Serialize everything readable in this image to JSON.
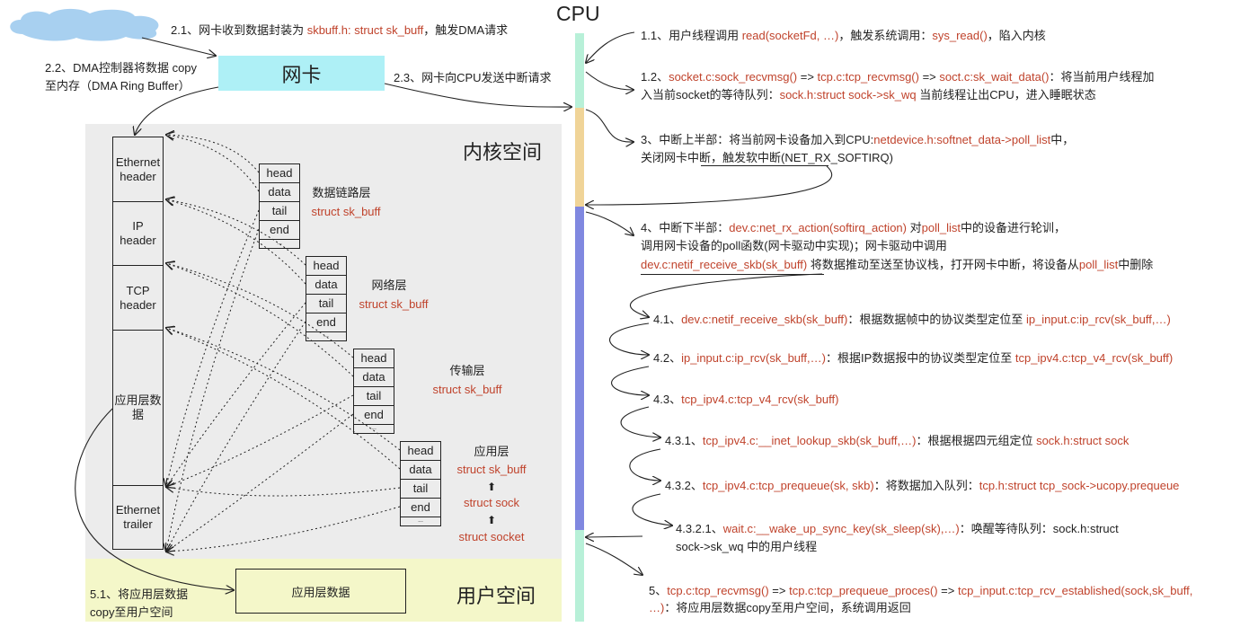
{
  "cpu_label": "CPU",
  "nic_label": "网卡",
  "kernel_space_label": "内核空间",
  "user_space_label": "用户空间",
  "colors": {
    "nic": "#aef0f6",
    "cpu_user": "#b8f0d8",
    "cpu_hardirq": "#f0d498",
    "cpu_softirq": "#8088e0",
    "kernel": "#ececec",
    "user": "#f4f7c9",
    "highlight": "#c0432c",
    "cloud": "#a8d0f0"
  },
  "left_notes": {
    "n21": [
      {
        "t": "2.1、网卡收到数据封装为 "
      },
      {
        "t": "skbuff.h: struct sk_buff",
        "hl": true
      },
      {
        "t": "，触发DMA请求"
      }
    ],
    "n22a": [
      {
        "t": "2.2、DMA控制器将数据 copy"
      }
    ],
    "n22b": [
      {
        "t": "至内存（DMA Ring Buffer）"
      }
    ],
    "n23": [
      {
        "t": "2.3、网卡向CPU发送中断请求"
      }
    ],
    "n51a": [
      {
        "t": "5.1、将应用层数据"
      }
    ],
    "n51b": [
      {
        "t": "copy至用户空间"
      }
    ]
  },
  "packet": [
    "Ethernet header",
    "IP header",
    "TCP header",
    "应用层数据",
    "Ethernet trailer"
  ],
  "skbuff_fields": [
    "head",
    "data",
    "tail",
    "end",
    "..."
  ],
  "layers": [
    {
      "name": "数据链路层",
      "struct": "struct sk_buff"
    },
    {
      "name": "网络层",
      "struct": "struct sk_buff"
    },
    {
      "name": "传输层",
      "struct": "struct sk_buff"
    },
    {
      "name": "应用层",
      "struct": "struct sk_buff",
      "extra": [
        "struct sock",
        "struct socket"
      ]
    }
  ],
  "user_box": "应用层数据",
  "steps": [
    {
      "id": "1.1",
      "lines": [
        [
          {
            "t": "1.1、用户线程调用 "
          },
          {
            "t": "read(socketFd, …)",
            "hl": true
          },
          {
            "t": "，触发系统调用："
          },
          {
            "t": "sys_read()",
            "hl": true
          },
          {
            "t": "，陷入内核"
          }
        ]
      ]
    },
    {
      "id": "1.2",
      "lines": [
        [
          {
            "t": "1.2、"
          },
          {
            "t": "socket.c:sock_recvmsg()",
            "hl": true
          },
          {
            "t": " => "
          },
          {
            "t": "tcp.c:tcp_recvmsg()",
            "hl": true
          },
          {
            "t": " => "
          },
          {
            "t": "soct.c:sk_wait_data()",
            "hl": true
          },
          {
            "t": "：将当前用户线程加"
          }
        ],
        [
          {
            "t": "入当前socket的等待队列："
          },
          {
            "t": "sock.h:struct sock->sk_wq",
            "hl": true
          },
          {
            "t": " 当前线程让出CPU，进入睡眠状态"
          }
        ]
      ]
    },
    {
      "id": "3",
      "lines": [
        [
          {
            "t": "3、中断上半部：将当前网卡设备加入到CPU:"
          },
          {
            "t": "netdevice.h:softnet_data->poll_list",
            "hl": true
          },
          {
            "t": "中，"
          }
        ],
        [
          {
            "t": "关闭网卡中断，触发软中断(NET_RX_SOFTIRQ)"
          }
        ]
      ]
    },
    {
      "id": "4",
      "lines": [
        [
          {
            "t": "4、中断下半部："
          },
          {
            "t": "dev.c:net_rx_action(softirq_action)",
            "hl": true
          },
          {
            "t": " 对"
          },
          {
            "t": "poll_list",
            "hl": true
          },
          {
            "t": "中的设备进行轮训，"
          }
        ],
        [
          {
            "t": "调用网卡设备的poll函数(网卡驱动中实现)；网卡驱动中调用"
          }
        ],
        [
          {
            "t": "dev.c:netif_receive_skb(sk_buff)",
            "hl": true
          },
          {
            "t": " 将数据推动至送至协议栈，打开网卡中断，将设备从"
          },
          {
            "t": "poll_list",
            "hl": true
          },
          {
            "t": "中删除"
          }
        ]
      ]
    },
    {
      "id": "4.1",
      "lines": [
        [
          {
            "t": "4.1、"
          },
          {
            "t": "dev.c:netif_receive_skb(sk_buff)",
            "hl": true
          },
          {
            "t": "：根据数据帧中的协议类型定位至 "
          },
          {
            "t": "ip_input.c:ip_rcv(sk_buff,…)",
            "hl": true
          }
        ]
      ]
    },
    {
      "id": "4.2",
      "lines": [
        [
          {
            "t": "4.2、"
          },
          {
            "t": "ip_input.c:ip_rcv(sk_buff,…)",
            "hl": true
          },
          {
            "t": "：根据IP数据报中的协议类型定位至 "
          },
          {
            "t": "tcp_ipv4.c:tcp_v4_rcv(sk_buff)",
            "hl": true
          }
        ]
      ]
    },
    {
      "id": "4.3",
      "lines": [
        [
          {
            "t": "4.3、"
          },
          {
            "t": "tcp_ipv4.c:tcp_v4_rcv(sk_buff)",
            "hl": true
          }
        ]
      ]
    },
    {
      "id": "4.3.1",
      "lines": [
        [
          {
            "t": "4.3.1、"
          },
          {
            "t": "tcp_ipv4.c:__inet_lookup_skb(sk_buff,…)",
            "hl": true
          },
          {
            "t": "：根据根据四元组定位 "
          },
          {
            "t": "sock.h:struct sock",
            "hl": true
          }
        ]
      ]
    },
    {
      "id": "4.3.2",
      "lines": [
        [
          {
            "t": "4.3.2、"
          },
          {
            "t": "tcp_ipv4.c:tcp_prequeue(sk, skb)",
            "hl": true
          },
          {
            "t": "：将数据加入队列："
          },
          {
            "t": "tcp.h:struct tcp_sock->ucopy.prequeue",
            "hl": true
          }
        ]
      ]
    },
    {
      "id": "4.3.2.1",
      "lines": [
        [
          {
            "t": "4.3.2.1、"
          },
          {
            "t": "wait.c:__wake_up_sync_key(sk_sleep(sk),…)",
            "hl": true
          },
          {
            "t": "：唤醒等待队列：sock.h:struct"
          }
        ],
        [
          {
            "t": "sock->sk_wq 中的用户线程"
          }
        ]
      ]
    },
    {
      "id": "5",
      "lines": [
        [
          {
            "t": "5、"
          },
          {
            "t": "tcp.c:tcp_recvmsg()",
            "hl": true
          },
          {
            "t": " => "
          },
          {
            "t": "tcp.c:tcp_prequeue_proces()",
            "hl": true
          },
          {
            "t": "  => "
          },
          {
            "t": "tcp_input.c:tcp_rcv_established(sock,sk_buff,",
            "hl": true
          }
        ],
        [
          {
            "t": "…)",
            "hl": true
          },
          {
            "t": "：将应用层数据copy至用户空间，系统调用返回"
          }
        ]
      ]
    }
  ]
}
